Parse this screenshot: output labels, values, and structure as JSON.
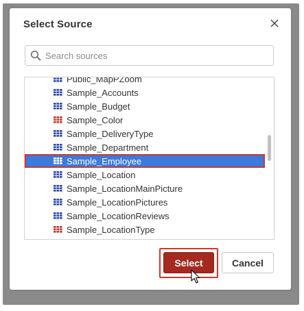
{
  "dialog": {
    "title": "Select Source",
    "close_icon": "close-icon"
  },
  "search": {
    "placeholder": "Search sources",
    "value": "",
    "icon": "search-icon"
  },
  "list": {
    "items": [
      {
        "label": "Public_MapPZoom",
        "icon": "table-icon",
        "icon_color": "#2b4aa8"
      },
      {
        "label": "Sample_Accounts",
        "icon": "table-icon",
        "icon_color": "#2b4aa8"
      },
      {
        "label": "Sample_Budget",
        "icon": "table-icon",
        "icon_color": "#2b4aa8"
      },
      {
        "label": "Sample_Color",
        "icon": "table-icon",
        "icon_color": "#c0392b"
      },
      {
        "label": "Sample_DeliveryType",
        "icon": "table-icon",
        "icon_color": "#2b4aa8"
      },
      {
        "label": "Sample_Department",
        "icon": "table-icon",
        "icon_color": "#2b4aa8"
      },
      {
        "label": "Sample_Employee",
        "icon": "table-icon",
        "icon_color": "#ffffff",
        "selected": true
      },
      {
        "label": "Sample_Location",
        "icon": "table-icon",
        "icon_color": "#2b4aa8"
      },
      {
        "label": "Sample_LocationMainPicture",
        "icon": "table-icon",
        "icon_color": "#2b4aa8"
      },
      {
        "label": "Sample_LocationPictures",
        "icon": "table-icon",
        "icon_color": "#2b4aa8"
      },
      {
        "label": "Sample_LocationReviews",
        "icon": "table-icon",
        "icon_color": "#2b4aa8"
      },
      {
        "label": "Sample_LocationType",
        "icon": "table-icon",
        "icon_color": "#c0392b"
      }
    ]
  },
  "buttons": {
    "select_label": "Select",
    "cancel_label": "Cancel"
  },
  "colors": {
    "accent": "#a5291f",
    "selection": "#3a7be0",
    "highlight": "#d0362c"
  }
}
